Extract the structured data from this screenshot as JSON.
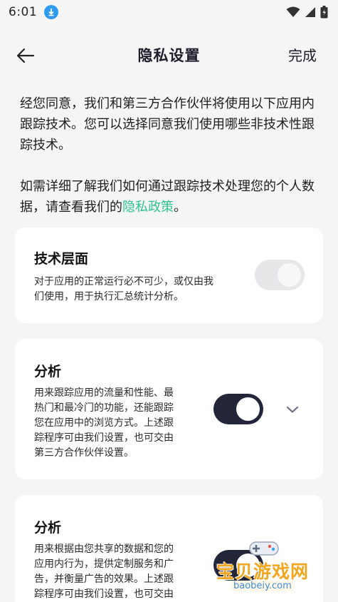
{
  "status_bar": {
    "time": "6:01"
  },
  "header": {
    "title": "隐私设置",
    "done_label": "完成"
  },
  "intro": {
    "paragraph1": "经您同意，我们和第三方合作伙伴将使用以下应用内跟踪技术。您可以选择同意我们使用哪些非技术性跟踪技术。",
    "paragraph2_prefix": "如需详细了解我们如何通过跟踪技术处理您的个人数据，请查看我们的",
    "privacy_link": "隐私政策",
    "paragraph2_suffix": "。"
  },
  "cards": [
    {
      "title": "技术层面",
      "desc_lines": [
        "对于应用的正常运行必不可少，或仅由我",
        "们使用，用于执行汇总统计分析。"
      ],
      "toggle_state": "on-disabled"
    },
    {
      "title": "分析",
      "desc_lines": [
        "用来跟踪应用的流量和性能、最",
        "热门和最冷门的功能，还能跟踪",
        "您在应用中的浏览方式。上述跟",
        "踪程序可由我们设置，也可交由",
        "第三方合作伙伴设置。"
      ],
      "toggle_state": "on"
    },
    {
      "title": "分析",
      "desc_lines": [
        "用来根据由您共享的数据和您的",
        "应用内行为，提供定制服务和广",
        "告，并衡量广告的效果。上述跟",
        "踪程序可由我们设置，也可交由"
      ],
      "toggle_state": "on"
    }
  ],
  "watermark": {
    "text": "宝贝游戏网",
    "url": "baobeiy.com"
  },
  "colors": {
    "accent_link": "#2ec48f",
    "toggle_on": "#232539",
    "toggle_disabled": "#e7e7e9",
    "download_badge": "#2f9bf0"
  },
  "icons": [
    "download-icon",
    "wifi-icon",
    "signal-icon",
    "battery-icon",
    "back-arrow-icon",
    "chevron-down-icon"
  ]
}
